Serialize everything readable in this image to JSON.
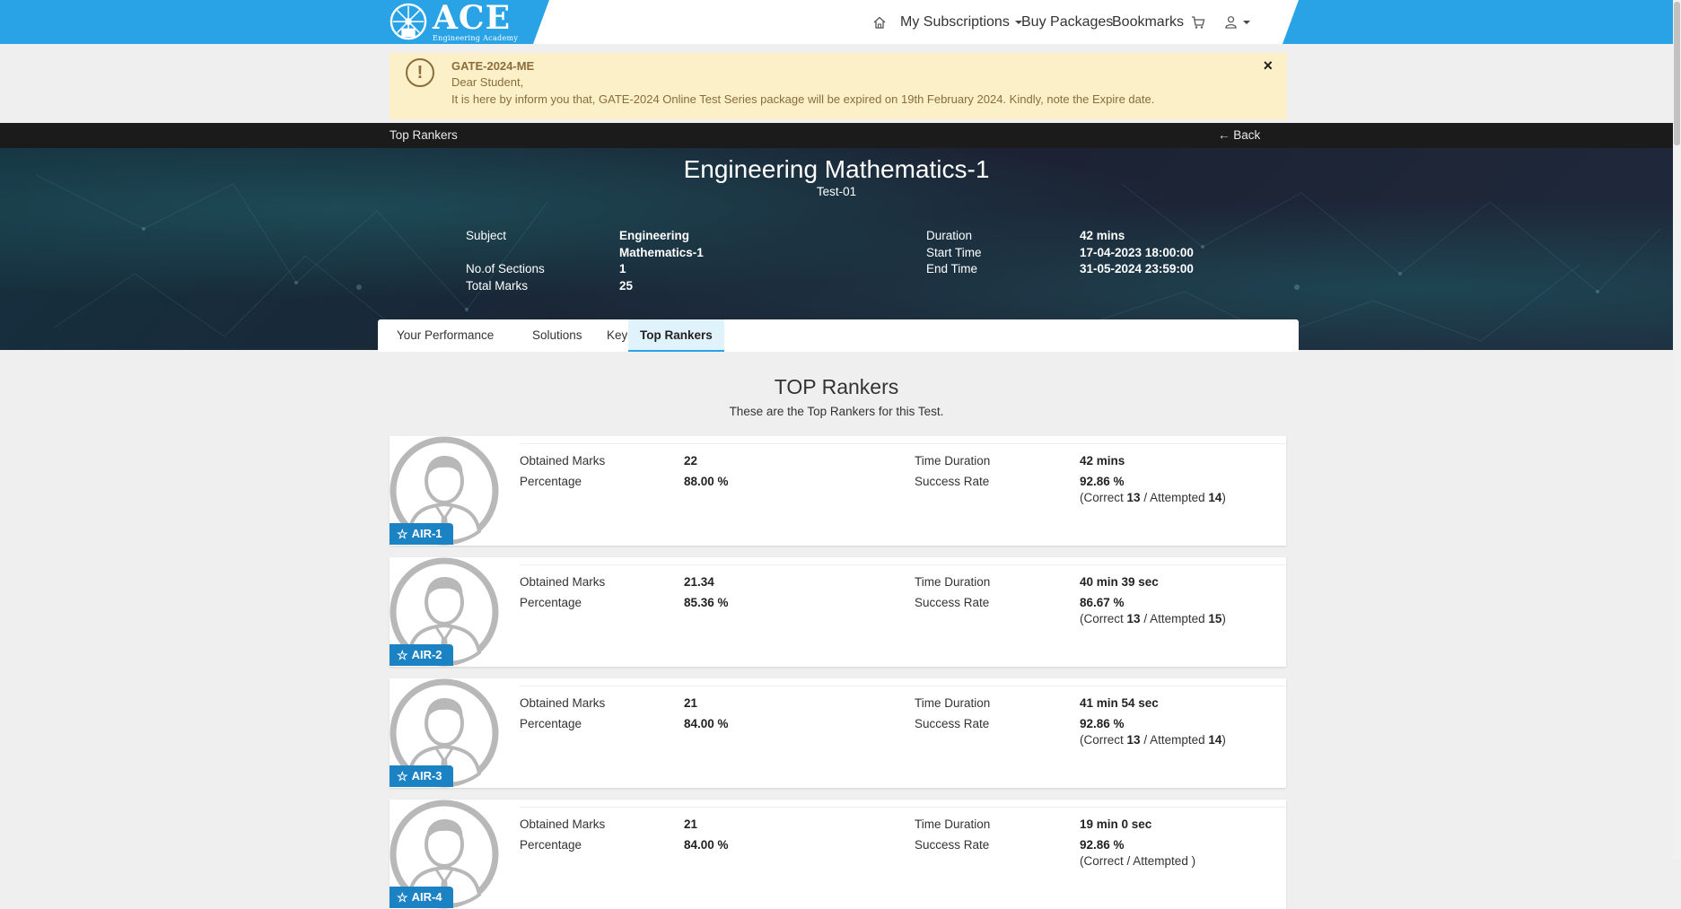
{
  "header": {
    "logo_main": "ACE",
    "logo_sub": "Engineering Academy",
    "nav": {
      "subscriptions": "My Subscriptions",
      "buy_packages": "Buy Packages",
      "bookmarks": "Bookmarks"
    },
    "icons": [
      "home-icon",
      "cart-icon",
      "user-icon"
    ],
    "accent_color": "#29a3e6"
  },
  "alert": {
    "title": "GATE-2024-ME",
    "line1": "Dear Student,",
    "line2": "It is here by inform you that, GATE-2024 Online Test Series package will be expired on 19th February 2024. Kindly, note the Expire date.",
    "close": "×"
  },
  "breadcrumb": {
    "title": "Top Rankers",
    "back": "Back"
  },
  "test": {
    "name": "Engineering Mathematics-1",
    "code": "Test-01",
    "labels": {
      "subject": "Subject",
      "sections": "No.of Sections",
      "total_marks": "Total Marks",
      "duration": "Duration",
      "start": "Start Time",
      "end": "End Time"
    },
    "subject_line1": "Engineering",
    "subject_line2": "Mathematics-1",
    "sections": "1",
    "total_marks": "25",
    "duration": "42 mins",
    "start": "17-04-2023 18:00:00",
    "end": "31-05-2024 23:59:00"
  },
  "tabs": [
    {
      "label": "Your Performance"
    },
    {
      "label": "Solutions"
    },
    {
      "label": "Key"
    },
    {
      "label": "Top Rankers",
      "active": true
    }
  ],
  "rankers_section": {
    "title": "TOP Rankers",
    "subtitle": "These are the Top Rankers for this Test.",
    "labels": {
      "obtained": "Obtained Marks",
      "percentage": "Percentage",
      "time": "Time Duration",
      "success": "Success Rate",
      "correct": "(Correct",
      "attempted": "/ Attempted",
      "close_paren": ")"
    }
  },
  "rankers": [
    {
      "rank": "AIR-1",
      "marks": "22",
      "percentage": "88.00 %",
      "time": "42 mins",
      "success": "92.86 %",
      "correct": "13",
      "attempted": "14"
    },
    {
      "rank": "AIR-2",
      "marks": "21.34",
      "percentage": "85.36 %",
      "time": "40 min 39 sec",
      "success": "86.67 %",
      "correct": "13",
      "attempted": "15"
    },
    {
      "rank": "AIR-3",
      "marks": "21",
      "percentage": "84.00 %",
      "time": "41 min 54 sec",
      "success": "92.86 %",
      "correct": "13",
      "attempted": "14"
    },
    {
      "rank": "AIR-4",
      "marks": "21",
      "percentage": "84.00 %",
      "time": "19 min 0 sec",
      "success": "92.86 %",
      "correct": "",
      "attempted": ""
    }
  ]
}
